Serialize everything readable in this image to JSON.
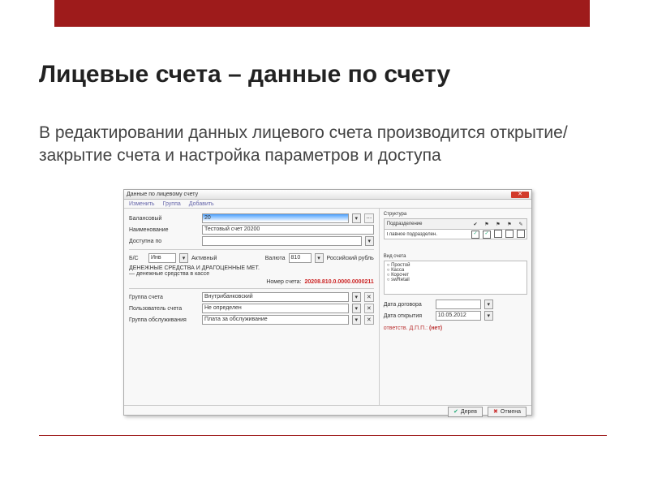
{
  "slide": {
    "title": "Лицевые счета – данные по счету",
    "description": "В редактировании данных лицевого счета производится открытие/закрытие счета и настройка параметров и доступа"
  },
  "win": {
    "title": "Данные по лицевому счету",
    "menu": {
      "m1": "Изменить",
      "m2": "Группа",
      "m3": "Добавить"
    },
    "close": "✕",
    "labels": {
      "balance": "Балансовый",
      "name": "Наименование",
      "access": "Доступна по",
      "bs_prefix": "Б/С",
      "active": "Активный",
      "currency": "Валюта",
      "currency_name": "Российский рубль",
      "section": "ДЕНЕЖНЫЕ СРЕДСТВА И ДРАГОЦЕННЫЕ МЕТ.",
      "subsection": "— денежные средства в кассе",
      "acct_label": "Номер счета:",
      "group": "Группа счета",
      "user": "Пользователь счета",
      "servgrp": "Группа обслуживания",
      "side_title": "Вид счета",
      "contract_date": "Дата договора",
      "open_date": "Дата открытия",
      "owner": "ответств. Д.П.П.:",
      "owner_none": "(нет)",
      "tree_header": "Подразделение"
    },
    "values": {
      "balance": "20",
      "name": "Тестовый счет 20200",
      "bs": "Инв",
      "currency": "810",
      "acct": "20208.810.0.0000.0000211",
      "group": "Внутрибанковский",
      "user": "Не определен",
      "servgrp": "Плата за обслуживание",
      "side1": "Простой",
      "side2": "Касса",
      "side3": "Корсчет",
      "side4": "swRetail",
      "open_date": "10.05.2012",
      "tree_row1": "Главное подразделен."
    },
    "buttons": {
      "ok": "Дерев",
      "cancel": "Отмена"
    }
  }
}
